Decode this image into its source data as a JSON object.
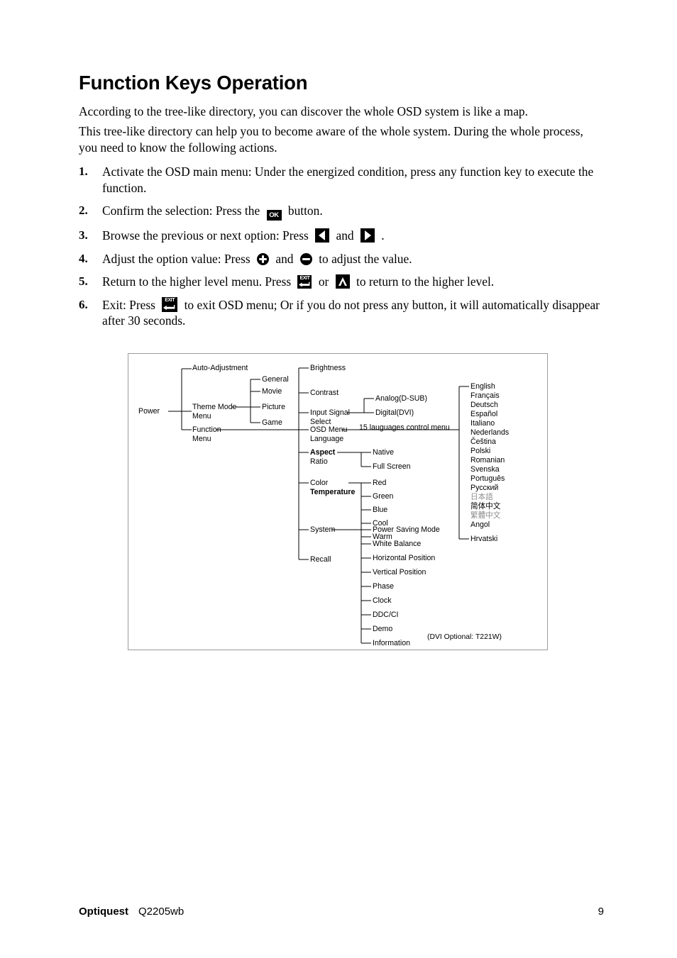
{
  "document": {
    "title": "Function Keys Operation",
    "intro": [
      "According to the tree-like directory, you can discover the whole OSD system is like a map.",
      "This tree-like directory can help you to become aware of the whole system. During the whole process, you need to know the following actions."
    ]
  },
  "steps": [
    {
      "num": "1.",
      "parts": [
        {
          "type": "text",
          "value": "Activate the OSD main menu: Under the energized condition, press any function key to execute the function."
        }
      ]
    },
    {
      "num": "2.",
      "parts": [
        {
          "type": "text",
          "value": "Confirm the selection: Press the "
        },
        {
          "type": "icon",
          "icon": "ok-button-icon",
          "label": "OK"
        },
        {
          "type": "text",
          "value": " button."
        }
      ]
    },
    {
      "num": "3.",
      "parts": [
        {
          "type": "text",
          "value": "Browse the previous or next option: Press "
        },
        {
          "type": "icon",
          "icon": "chevron-left-icon"
        },
        {
          "type": "text",
          "value": " and "
        },
        {
          "type": "icon",
          "icon": "chevron-right-icon"
        },
        {
          "type": "text",
          "value": " ."
        }
      ]
    },
    {
      "num": "4.",
      "parts": [
        {
          "type": "text",
          "value": "Adjust the option value: Press "
        },
        {
          "type": "icon",
          "icon": "plus-icon"
        },
        {
          "type": "text",
          "value": " and "
        },
        {
          "type": "icon",
          "icon": "minus-icon"
        },
        {
          "type": "text",
          "value": " to adjust the value."
        }
      ]
    },
    {
      "num": "5.",
      "parts": [
        {
          "type": "text",
          "value": "Return to the higher level menu. Press "
        },
        {
          "type": "icon",
          "icon": "exit-icon",
          "label": "EXIT"
        },
        {
          "type": "text",
          "value": " or "
        },
        {
          "type": "icon",
          "icon": "caret-up-icon"
        },
        {
          "type": "text",
          "value": " to return to the higher level."
        }
      ]
    },
    {
      "num": "6.",
      "parts": [
        {
          "type": "text",
          "value": "Exit: Press "
        },
        {
          "type": "icon",
          "icon": "exit-icon",
          "label": "EXIT"
        },
        {
          "type": "text",
          "value": " to exit OSD menu; Or if you do not press any button, it will automatically disappear after 30 seconds."
        }
      ]
    }
  ],
  "diagram": {
    "note": "(DVI Optional: T221W)",
    "languages_note": "15 lauguages control menu",
    "nodes": {
      "power": "Power",
      "auto_adjustment": "Auto-Adjustment",
      "theme_mode_menu": "Theme Mode\nMenu",
      "function_menu": "Function\nMenu",
      "general": "General",
      "movie": "Movie",
      "picture": "Picture",
      "game": "Game",
      "brightness": "Brightness",
      "contrast": "Contrast",
      "input_signal_select": "Input Signal\nSelect",
      "osd_menu_language": "OSD Menu\nLanguage",
      "aspect_ratio_line1": "Aspect",
      "aspect_ratio_line2": "Ratio",
      "color_temperature_line1": "Color",
      "color_temperature_line2": "Temperature",
      "system": "System",
      "recall": "Recall",
      "analog_dsub": "Analog(D-SUB)",
      "digital_dvi": "Digital(DVI)",
      "native": "Native",
      "full_screen": "Full Screen",
      "red": "Red",
      "green": "Green",
      "blue": "Blue",
      "cool": "Cool",
      "warm": "Warm",
      "power_saving_mode": "Power Saving Mode",
      "white_balance": "White Balance",
      "horizontal_position": "Horizontal Position",
      "vertical_position": "Vertical Position",
      "phase": "Phase",
      "clock": "Clock",
      "ddc_ci": "DDC/CI",
      "demo": "Demo",
      "information": "Information"
    },
    "languages": [
      "English",
      "Français",
      "Deutsch",
      "Español",
      "Italiano",
      "Nederlands",
      "Čeština",
      "Polski",
      "Romanian",
      "Svenska",
      "Português",
      "Русский",
      "日本語",
      "简体中文",
      "繁體中文",
      "Angol",
      "Hrvatski"
    ]
  },
  "footer": {
    "brand": "Optiquest",
    "model": "Q2205wb",
    "page_number": "9"
  }
}
